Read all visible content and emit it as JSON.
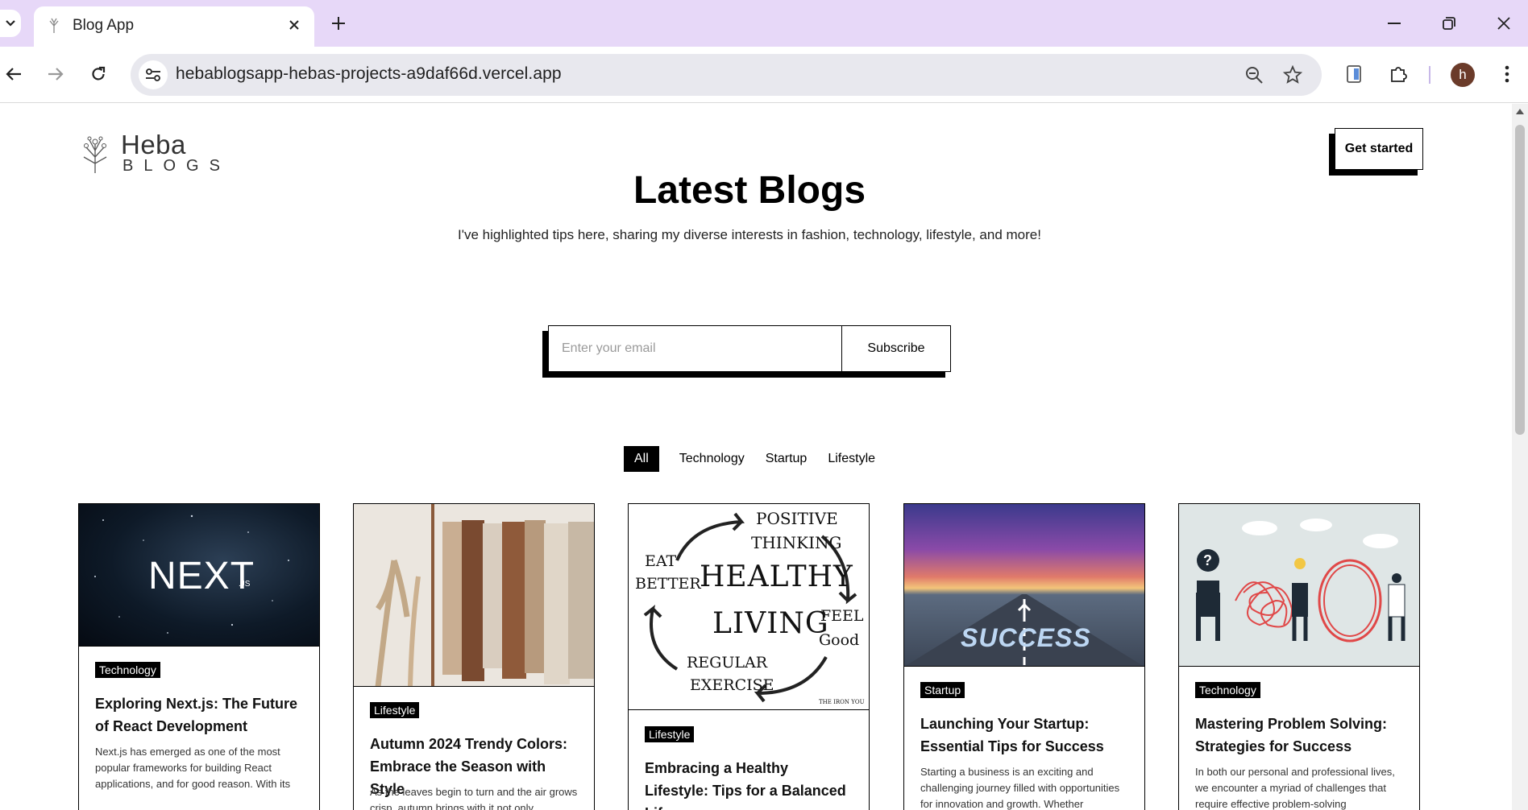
{
  "browser": {
    "tab_title": "Blog App",
    "url": "hebablogsapp-hebas-projects-a9daf66d.vercel.app",
    "avatar_letter": "h"
  },
  "site": {
    "logo_name": "Heba",
    "logo_sub": "BLOGS",
    "get_started": "Get started",
    "heading": "Latest Blogs",
    "subheading": "I've highlighted tips here, sharing my diverse interests in fashion, technology, lifestyle, and more!",
    "email_placeholder": "Enter your email",
    "subscribe_label": "Subscribe",
    "filters": [
      "All",
      "Technology",
      "Startup",
      "Lifestyle"
    ],
    "active_filter": "All"
  },
  "cards": [
    {
      "category": "Technology",
      "title": "Exploring Next.js: The Future of React Development",
      "description": "Next.js has emerged as one of the most popular frameworks for building React applications, and for good reason. With its",
      "image_text": "NEXT",
      "image_text_sub": ".JS"
    },
    {
      "category": "Lifestyle",
      "title": "Autumn 2024 Trendy Colors: Embrace the Season with Style",
      "description": "As the leaves begin to turn and the air grows crisp, autumn brings with it not only",
      "image_text": "",
      "image_text_sub": ""
    },
    {
      "category": "Lifestyle",
      "title": "Embracing a Healthy Lifestyle: Tips for a Balanced Life",
      "description": "",
      "image_words": [
        "POSITIVE",
        "THINKING",
        "EAT",
        "BETTER",
        "HEALTHY",
        "LIVING",
        "FEEL",
        "Good",
        "REGULAR",
        "EXERCISE",
        "THE IRON YOU"
      ]
    },
    {
      "category": "Startup",
      "title": "Launching Your Startup: Essential Tips for Success",
      "description": "Starting a business is an exciting and challenging journey filled with opportunities for innovation and growth. Whether",
      "image_text": "SUCCESS",
      "image_text_sub": ""
    },
    {
      "category": "Technology",
      "title": "Mastering Problem Solving: Strategies for Success",
      "description": "In both our personal and professional lives, we encounter a myriad of challenges that require effective problem-solving",
      "image_text": "?",
      "image_text_sub": ""
    }
  ]
}
